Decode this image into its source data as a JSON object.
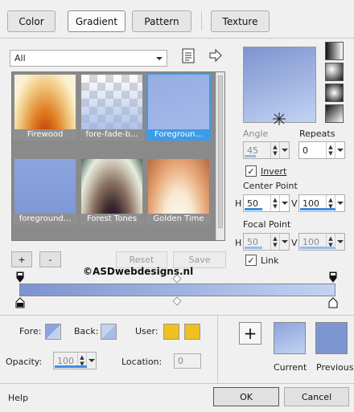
{
  "tabs": [
    {
      "label": "Color",
      "active": false
    },
    {
      "label": "Gradient",
      "active": true
    },
    {
      "label": "Pattern",
      "active": false
    },
    {
      "label": "Texture",
      "active": false
    }
  ],
  "category": {
    "value": "All"
  },
  "gallery": [
    {
      "name": "Firewood",
      "selected": false
    },
    {
      "name": "fore-fade-b...",
      "selected": false
    },
    {
      "name": "Foregroun...",
      "selected": true
    },
    {
      "name": "foreground...",
      "selected": false
    },
    {
      "name": "Forest Tones",
      "selected": false
    },
    {
      "name": "Golden Time",
      "selected": false
    }
  ],
  "gallery_buttons": {
    "add": "+",
    "remove": "-",
    "reset": "Reset",
    "save": "Save"
  },
  "watermark": "©ASDwebdesigns.nl",
  "gradient_colors": {
    "start": "#7d93cf",
    "end": "#c2d3f2"
  },
  "angle": {
    "label": "Angle",
    "value": "45",
    "enabled": false
  },
  "repeats": {
    "label": "Repeats",
    "value": "0"
  },
  "invert": {
    "label": "Invert",
    "checked": true
  },
  "center_point": {
    "label": "Center Point",
    "h_label": "H",
    "h": "50",
    "v_label": "V",
    "v": "100"
  },
  "focal_point": {
    "label": "Focal Point",
    "h_label": "H",
    "h": "50",
    "v_label": "V",
    "v": "100",
    "enabled": false
  },
  "link": {
    "label": "Link",
    "checked": true
  },
  "bottom": {
    "fore_label": "Fore:",
    "back_label": "Back:",
    "user_label": "User:",
    "user_colors": [
      "#f0c020",
      "#f0c020"
    ],
    "opacity_label": "Opacity:",
    "opacity_value": "100",
    "opacity_fraction": 1.0,
    "location_label": "Location:",
    "location_value": "0"
  },
  "previews": {
    "add": "+",
    "current": "Current",
    "previous": "Previous"
  },
  "footer": {
    "help": "Help",
    "ok": "OK",
    "cancel": "Cancel"
  }
}
